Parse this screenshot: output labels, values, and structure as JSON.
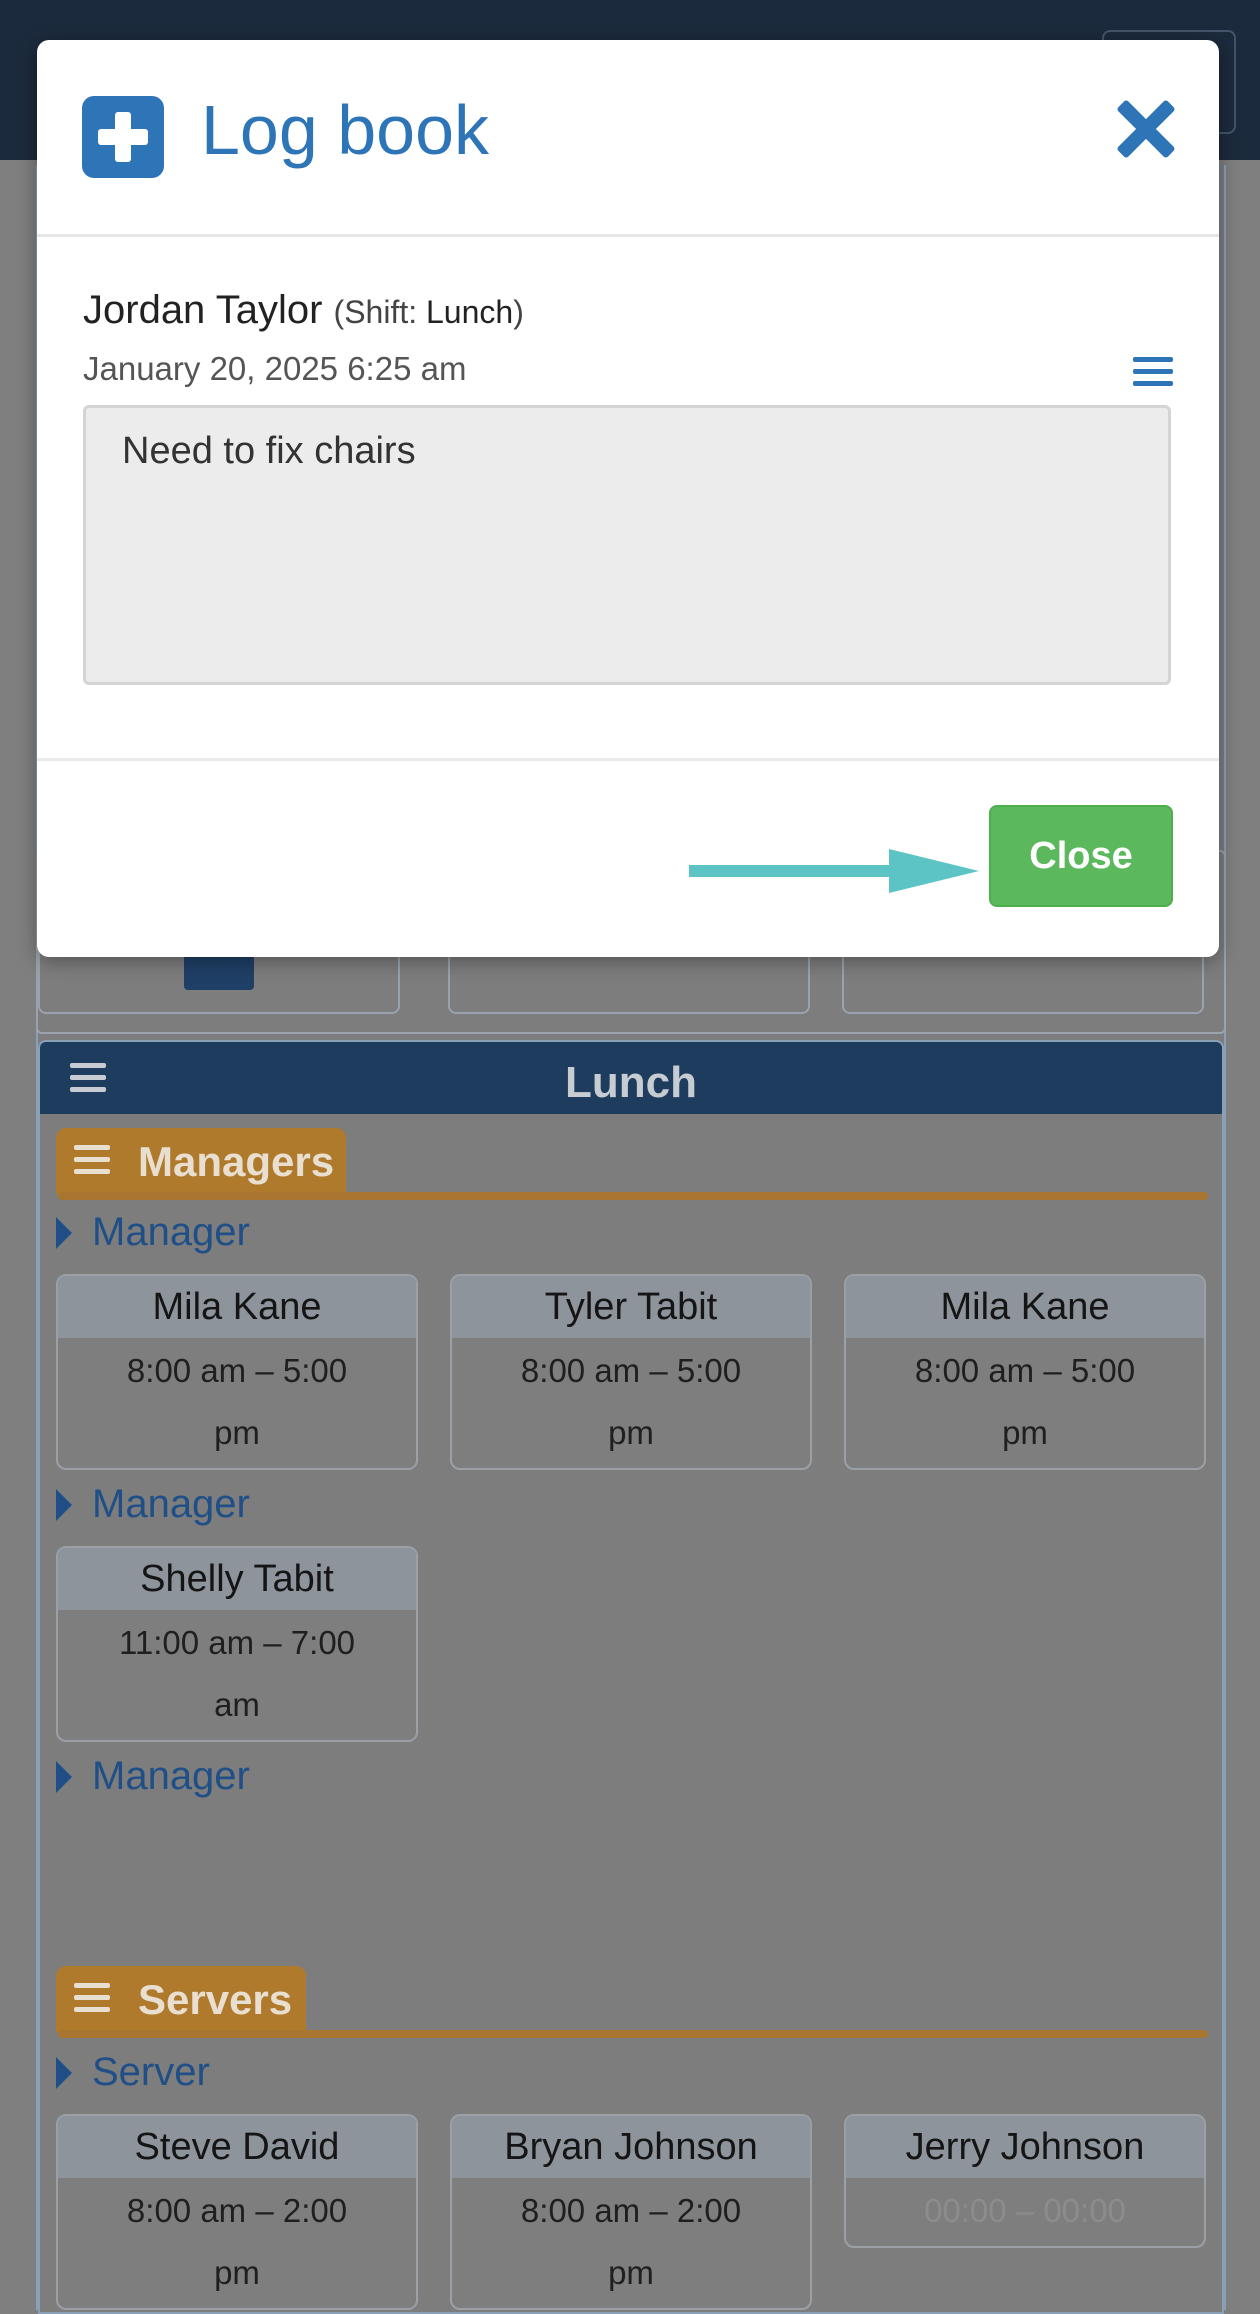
{
  "modal": {
    "title": "Log book",
    "entry": {
      "author": "Jordan Taylor",
      "shift_prefix": "(Shift: ",
      "shift_name": "Lunch",
      "shift_suffix": ")",
      "datetime": "January 20, 2025 6:25 am",
      "text": "Need to fix chairs"
    },
    "close_label": "Close"
  },
  "lunch": {
    "title": "Lunch",
    "managers": {
      "label": "Managers",
      "roles": [
        {
          "label": "Manager",
          "cards": [
            {
              "name": "Mila Kane",
              "time": "8:00 am  –  5:00",
              "time2": "pm"
            },
            {
              "name": "Tyler Tabit",
              "time": "8:00 am  –  5:00",
              "time2": "pm"
            },
            {
              "name": "Mila Kane",
              "time": "8:00 am  –  5:00",
              "time2": "pm"
            }
          ]
        },
        {
          "label": "Manager",
          "cards": [
            {
              "name": "Shelly Tabit",
              "time": "11:00 am  –  7:00",
              "time2": "am"
            }
          ]
        },
        {
          "label": "Manager",
          "cards": []
        }
      ]
    },
    "servers": {
      "label": "Servers",
      "roles": [
        {
          "label": "Server",
          "cards": [
            {
              "name": "Steve David",
              "time": "8:00 am  –  2:00",
              "time2": "pm"
            },
            {
              "name": "Bryan Johnson",
              "time": "8:00 am  –  2:00",
              "time2": "pm"
            },
            {
              "name": "Jerry Johnson",
              "time": "00:00  –  00:00",
              "time2": ""
            }
          ]
        }
      ]
    }
  },
  "colors": {
    "accent": "#2e75b8",
    "close_button": "#5cb85c",
    "arrow": "#5cc4c4",
    "group_tab": "#b07a2c",
    "lunch_header": "#1e3d5e"
  },
  "icons": [
    "plus-square-icon",
    "close-icon",
    "hamburger-menu-icon",
    "caret-right-icon",
    "arrow-right-icon"
  ]
}
